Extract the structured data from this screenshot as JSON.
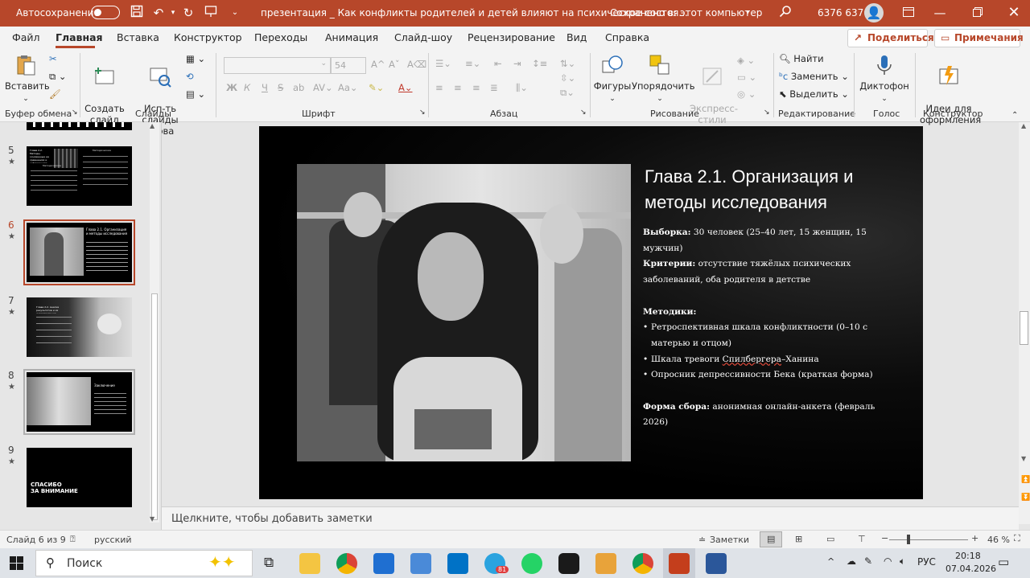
{
  "titlebar": {
    "autosave_label": "Автосохранение",
    "autosave_state": "Откл.",
    "doc_title": "презентация _ Как конфликты родителей и детей влияют на психическое состоя...",
    "save_status": "Сохранено в: этот компьютер",
    "user_name": "6376 6376"
  },
  "menu": {
    "items": [
      "Файл",
      "Главная",
      "Вставка",
      "Конструктор",
      "Переходы",
      "Анимация",
      "Слайд-шоу",
      "Рецензирование",
      "Вид",
      "Справка"
    ],
    "share": "Поделиться",
    "comments": "Примечания"
  },
  "ribbon": {
    "paste": "Вставить",
    "clipboard_group": "Буфер обмена",
    "new_slide": "Создать\nслайд",
    "reuse_slides": "Исп-ть\nслайды снова",
    "slides_group": "Слайды",
    "font_size": "54",
    "font_group": "Шрифт",
    "paragraph_group": "Абзац",
    "shapes": "Фигуры",
    "arrange": "Упорядочить",
    "styles": "Экспресс-\nстили",
    "drawing_group": "Рисование",
    "find": "Найти",
    "replace": "Заменить",
    "select": "Выделить",
    "editing_group": "Редактирование",
    "dictate": "Диктофон",
    "voice_group": "Голос",
    "designer": "Идеи для\nоформления",
    "designer_group": "Конструктор",
    "bold": "Ж",
    "italic": "К",
    "underline": "Ч",
    "strike": "S",
    "abc": "ab"
  },
  "thumbnails": [
    {
      "num": "5",
      "title": "Глава 2.2. Методы, основанные на сравнениях и наблюдениях",
      "col1": "Методические",
      "col2": "Методические"
    },
    {
      "num": "6",
      "title": "Глава 2.1. Организация и методы исследования"
    },
    {
      "num": "7",
      "title": "Глава 2.2. Анализ результатов и их интерпретация"
    },
    {
      "num": "8",
      "title": "Заключение"
    },
    {
      "num": "9",
      "title": "СПАСИБО\nЗА ВНИМАНИЕ"
    }
  ],
  "slide": {
    "title_line1": "Глава 2.1. Организация и",
    "title_line2": "методы исследования",
    "sample_label": "Выборка:",
    "sample_text": " 30 человек (25–40 лет, 15 женщин, 15",
    "sample_text2": "мужчин)",
    "criteria_label": "Критерии:",
    "criteria_text": " отсутствие тяжёлых психических",
    "criteria_text2": "заболеваний, оба родителя в детстве",
    "methods_label": "Методики:",
    "method1": "Ретроспективная шкала конфликтности (0–10 с",
    "method1b": "матерью и отцом)",
    "method2a": "Шкала тревоги ",
    "method2b": "Спилбергера",
    "method2c": "–Ханина",
    "method3": "Опросник депрессивности Бека (краткая форма)",
    "form_label": "Форма сбора:",
    "form_text": " анонимная онлайн-анкета (февраль 2026)"
  },
  "notes_placeholder": "Щелкните, чтобы добавить заметки",
  "status": {
    "slide_counter": "Слайд 6 из 9",
    "language": "русский",
    "notes_btn": "Заметки",
    "zoom": "46 %"
  },
  "taskbar": {
    "search": "Поиск",
    "lang": "РУС",
    "time": "20:18",
    "date": "07.04.2026",
    "telegram_badge": "81"
  }
}
